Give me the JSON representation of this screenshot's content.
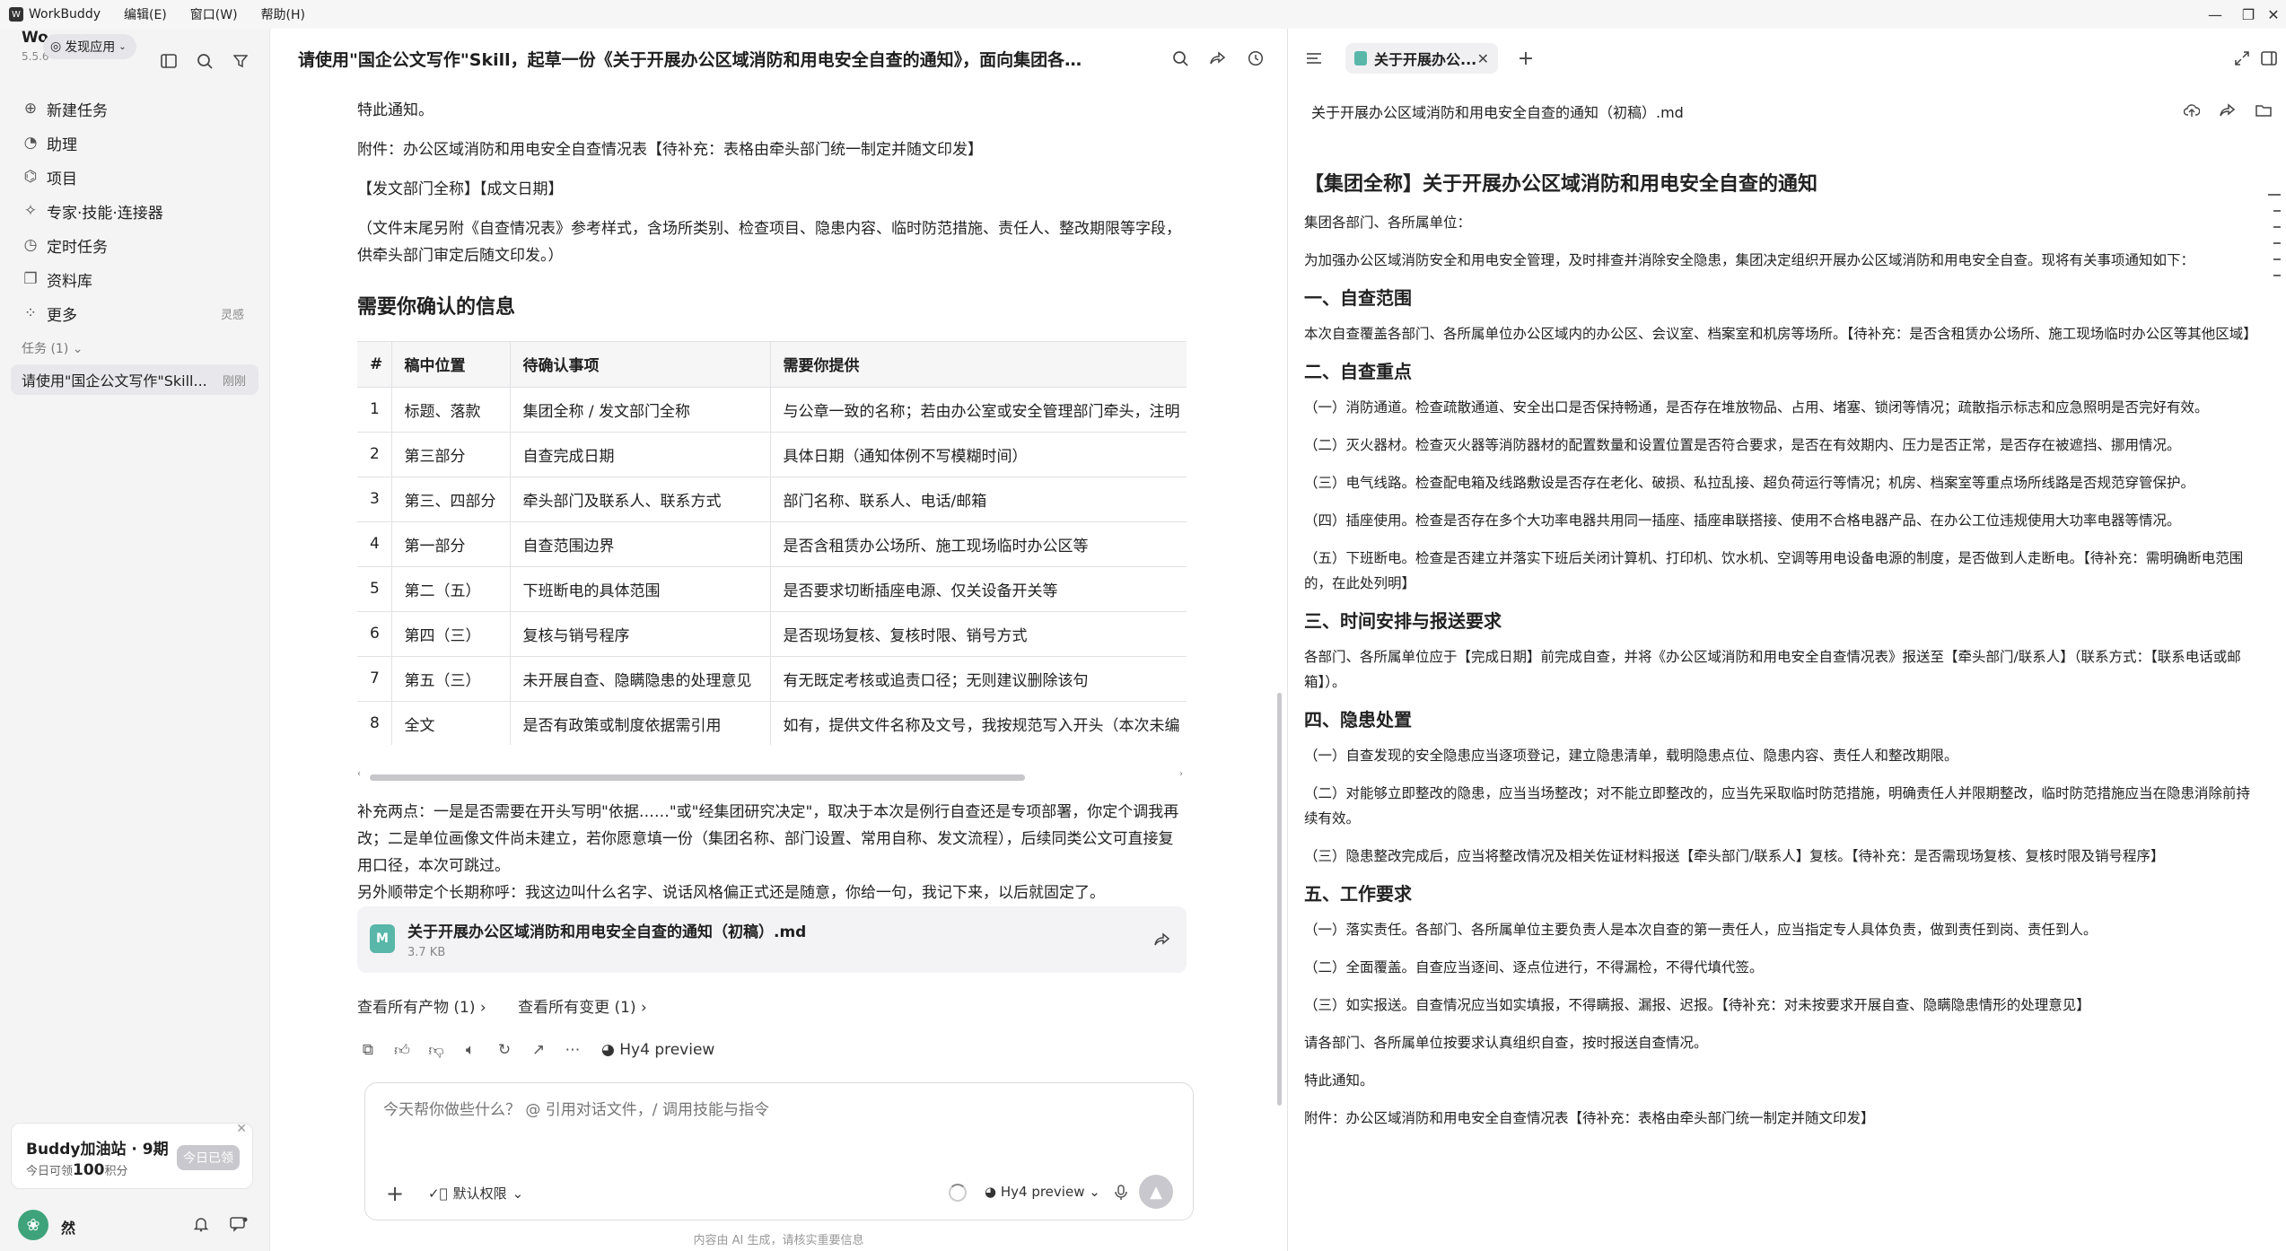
{
  "titlebar": {
    "app": "WorkBuddy",
    "menus": [
      "编辑(E)",
      "窗口(W)",
      "帮助(H)"
    ]
  },
  "sidebar": {
    "brand": "Wo",
    "version": "5.5.6",
    "discover": "发现应用",
    "nav": [
      {
        "label": "新建任务",
        "icon": "plus-circle-icon"
      },
      {
        "label": "助理",
        "icon": "assistant-icon"
      },
      {
        "label": "项目",
        "icon": "project-icon"
      },
      {
        "label": "专家·技能·连接器",
        "icon": "expert-icon"
      },
      {
        "label": "定时任务",
        "icon": "schedule-icon"
      },
      {
        "label": "资料库",
        "icon": "library-icon"
      },
      {
        "label": "更多",
        "icon": "more-icon",
        "trail": "灵感"
      }
    ],
    "tasks_header": "任务 (1)",
    "task": {
      "label": "请使用\"国企公文写作\"Skill...",
      "time": "刚刚"
    },
    "promo": {
      "title": "Buddy加油站 · 9期",
      "sub_pre": "今日可领",
      "points": "100",
      "sub_post": "积分",
      "button": "今日已领"
    },
    "user": {
      "name": "然"
    }
  },
  "main": {
    "title": "请使用\"国企公文写作\"Skill，起草一份《关于开展办公区域消防和用电安全自查的通知》，面向集团各部...",
    "p1": "特此通知。",
    "p2": "附件：办公区域消防和用电安全自查情况表【待补充：表格由牵头部门统一制定并随文印发】",
    "p3": "【发文部门全称】【成文日期】",
    "p4": "（文件末尾另附《自查情况表》参考样式，含场所类别、检查项目、隐患内容、临时防范措施、责任人、整改期限等字段，供牵头部门审定后随文印发。）",
    "h2": "需要你确认的信息",
    "table": {
      "headers": [
        "#",
        "稿中位置",
        "待确认事项",
        "需要你提供"
      ],
      "rows": [
        [
          "1",
          "标题、落款",
          "集团全称 / 发文部门全称",
          "与公章一致的名称；若由办公室或安全管理部门牵头，注明"
        ],
        [
          "2",
          "第三部分",
          "自查完成日期",
          "具体日期（通知体例不写模糊时间）"
        ],
        [
          "3",
          "第三、四部分",
          "牵头部门及联系人、联系方式",
          "部门名称、联系人、电话/邮箱"
        ],
        [
          "4",
          "第一部分",
          "自查范围边界",
          "是否含租赁办公场所、施工现场临时办公区等"
        ],
        [
          "5",
          "第二（五）",
          "下班断电的具体范围",
          "是否要求切断插座电源、仅关设备开关等"
        ],
        [
          "6",
          "第四（三）",
          "复核与销号程序",
          "是否现场复核、复核时限、销号方式"
        ],
        [
          "7",
          "第五（三）",
          "未开展自查、隐瞒隐患的处理意见",
          "有无既定考核或追责口径；无则建议删除该句"
        ],
        [
          "8",
          "全文",
          "是否有政策或制度依据需引用",
          "如有，提供文件名称及文号，我按规范写入开头（本次未编"
        ]
      ]
    },
    "p5": "补充两点：一是是否需要在开头写明\"依据……\"或\"经集团研究决定\"，取决于本次是例行自查还是专项部署，你定个调我再改；二是单位画像文件尚未建立，若你愿意填一份（集团名称、部门设置、常用自称、发文流程），后续同类公文可直接复用口径，本次可跳过。",
    "p6": "另外顺带定个长期称呼：我这边叫什么名字、说话风格偏正式还是随意，你给一句，我记下来，以后就固定了。",
    "file": {
      "icon": "M",
      "name": "关于开展办公区域消防和用电安全自查的通知（初稿）.md",
      "size": "3.7 KB"
    },
    "links": [
      "查看所有产物 (1) ›",
      "查看所有变更 (1) ›"
    ],
    "model": "Hy4 preview",
    "composer": {
      "placeholder": "今天帮你做些什么？ @ 引用对话文件，/ 调用技能与指令",
      "permission": "默认权限",
      "model": "Hy4 preview"
    },
    "disclaimer": "内容由 AI 生成，请核实重要信息"
  },
  "right": {
    "tab": "关于开展办公...",
    "filename": "关于开展办公区域消防和用电安全自查的通知（初稿）.md",
    "doc_title": "【集团全称】关于开展办公区域消防和用电安全自查的通知",
    "salutation": "集团各部门、各所属单位：",
    "intro": "为加强办公区域消防安全和用电安全管理，及时排查并消除安全隐患，集团决定组织开展办公区域消防和用电安全自查。现将有关事项通知如下：",
    "s1": "一、自查范围",
    "s1p": "本次自查覆盖各部门、各所属单位办公区域内的办公区、会议室、档案室和机房等场所。【待补充：是否含租赁办公场所、施工现场临时办公区等其他区域】",
    "s2": "二、自查重点",
    "s2p1": "（一）消防通道。检查疏散通道、安全出口是否保持畅通，是否存在堆放物品、占用、堵塞、锁闭等情况；疏散指示标志和应急照明是否完好有效。",
    "s2p2": "（二）灭火器材。检查灭火器等消防器材的配置数量和设置位置是否符合要求，是否在有效期内、压力是否正常，是否存在被遮挡、挪用情况。",
    "s2p3": "（三）电气线路。检查配电箱及线路敷设是否存在老化、破损、私拉乱接、超负荷运行等情况；机房、档案室等重点场所线路是否规范穿管保护。",
    "s2p4": "（四）插座使用。检查是否存在多个大功率电器共用同一插座、插座串联搭接、使用不合格电器产品、在办公工位违规使用大功率电器等情况。",
    "s2p5": "（五）下班断电。检查是否建立并落实下班后关闭计算机、打印机、饮水机、空调等用电设备电源的制度，是否做到人走断电。【待补充：需明确断电范围的，在此处列明】",
    "s3": "三、时间安排与报送要求",
    "s3p": "各部门、各所属单位应于【完成日期】前完成自查，并将《办公区域消防和用电安全自查情况表》报送至【牵头部门/联系人】（联系方式：【联系电话或邮箱】）。",
    "s4": "四、隐患处置",
    "s4p1": "（一）自查发现的安全隐患应当逐项登记，建立隐患清单，载明隐患点位、隐患内容、责任人和整改期限。",
    "s4p2": "（二）对能够立即整改的隐患，应当当场整改；对不能立即整改的，应当先采取临时防范措施，明确责任人并限期整改，临时防范措施应当在隐患消除前持续有效。",
    "s4p3": "（三）隐患整改完成后，应当将整改情况及相关佐证材料报送【牵头部门/联系人】复核。【待补充：是否需现场复核、复核时限及销号程序】",
    "s5": "五、工作要求",
    "s5p1": "（一）落实责任。各部门、各所属单位主要负责人是本次自查的第一责任人，应当指定专人具体负责，做到责任到岗、责任到人。",
    "s5p2": "（二）全面覆盖。自查应当逐间、逐点位进行，不得漏检，不得代填代签。",
    "s5p3": "（三）如实报送。自查情况应当如实填报，不得瞒报、漏报、迟报。【待补充：对未按要求开展自查、隐瞒隐患情形的处理意见】",
    "close": "请各部门、各所属单位按要求认真组织自查，按时报送自查情况。",
    "end": "特此通知。",
    "attach": "附件：办公区域消防和用电安全自查情况表【待补充：表格由牵头部门统一制定并随文印发】"
  }
}
